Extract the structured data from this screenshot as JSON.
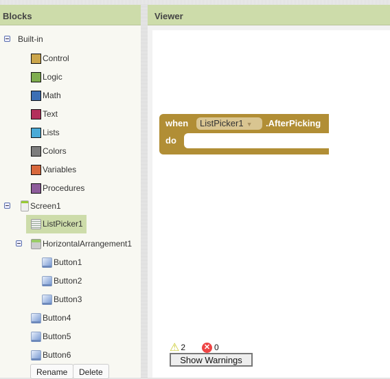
{
  "blocks_panel": {
    "title": "Blocks",
    "builtin_label": "Built-in",
    "builtin": [
      {
        "label": "Control",
        "color": "#cba54b"
      },
      {
        "label": "Logic",
        "color": "#7fad4f"
      },
      {
        "label": "Math",
        "color": "#3d6fb5"
      },
      {
        "label": "Text",
        "color": "#b3305b"
      },
      {
        "label": "Lists",
        "color": "#4aaad6"
      },
      {
        "label": "Colors",
        "color": "#7d7d7d"
      },
      {
        "label": "Variables",
        "color": "#d8683c"
      },
      {
        "label": "Procedures",
        "color": "#8d5c9b"
      }
    ],
    "screen": "Screen1",
    "components": [
      "ListPicker1",
      "HorizontalArrangement1",
      "Button1",
      "Button2",
      "Button3",
      "Button4",
      "Button5",
      "Button6"
    ],
    "selected": "ListPicker1",
    "rename_label": "Rename",
    "delete_label": "Delete"
  },
  "viewer": {
    "title": "Viewer",
    "block": {
      "when": "when",
      "component": "ListPicker1",
      "event": ".AfterPicking",
      "do": "do",
      "color": "#b18e35"
    },
    "warnings_count": "2",
    "errors_count": "0",
    "show_warnings_label": "Show Warnings"
  }
}
